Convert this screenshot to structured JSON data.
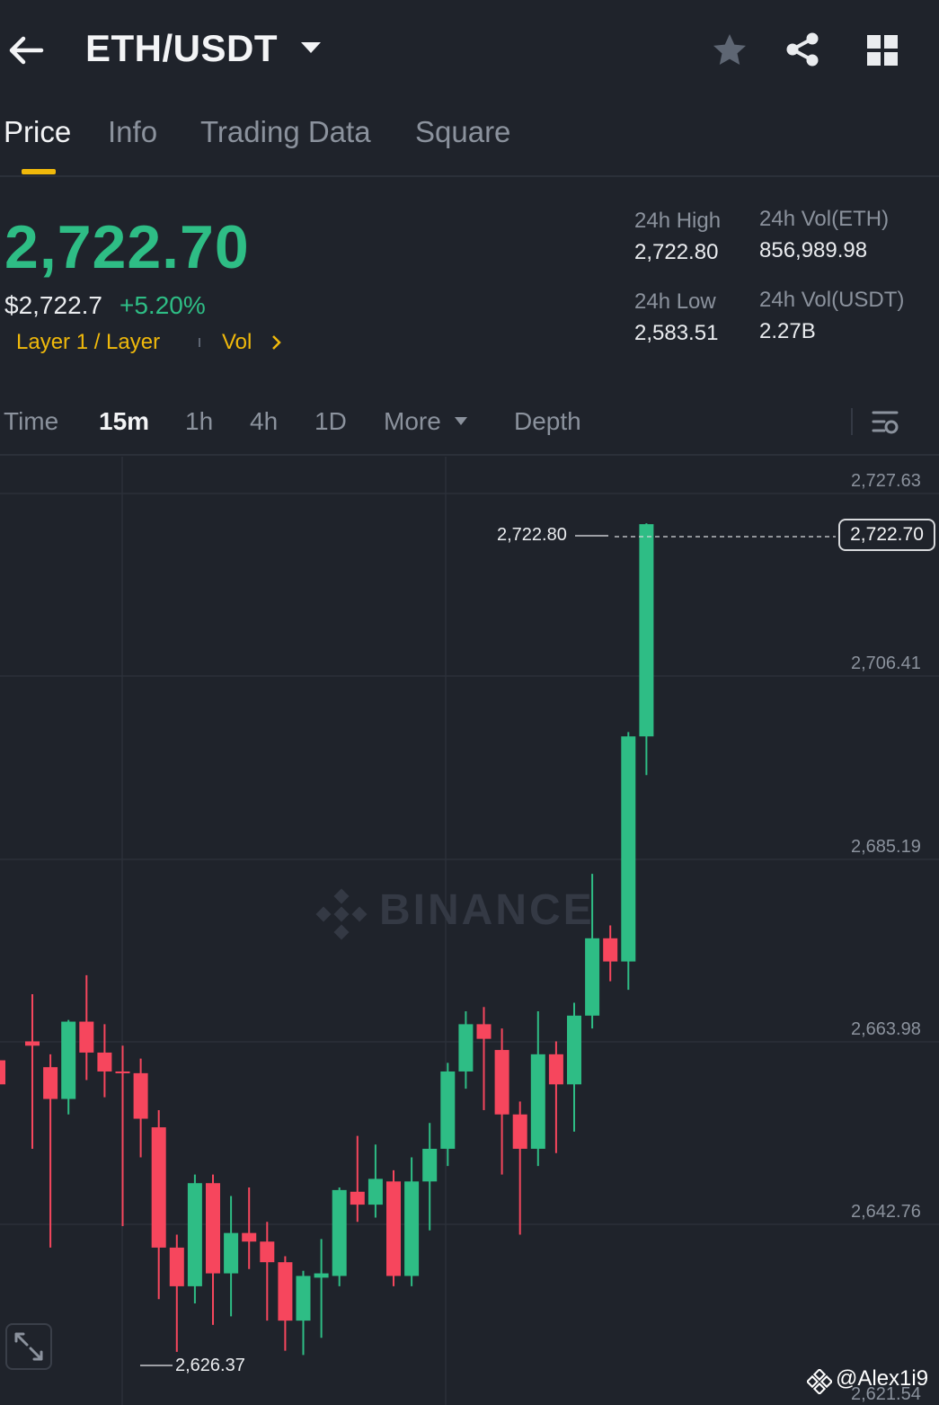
{
  "header": {
    "pair": "ETH/USDT",
    "back_icon": "back-arrow-icon",
    "dropdown_icon": "caret-down-icon",
    "favorite_icon": "star-icon",
    "share_icon": "share-icon",
    "grid_icon": "grid-icon"
  },
  "tabs": [
    {
      "label": "Price",
      "active": true
    },
    {
      "label": "Info"
    },
    {
      "label": "Trading Data"
    },
    {
      "label": "Square"
    }
  ],
  "ticker": {
    "last_price": "2,722.70",
    "fiat_price": "$2,722.7",
    "change_pct": "+5.20%",
    "tag": "Layer 1 / Layer",
    "vol_link": "Vol",
    "stats": {
      "high_label": "24h High",
      "high_value": "2,722.80",
      "vol_eth_label": "24h Vol(ETH)",
      "vol_eth_value": "856,989.98",
      "low_label": "24h Low",
      "low_value": "2,583.51",
      "vol_usdt_label": "24h Vol(USDT)",
      "vol_usdt_value": "2.27B"
    }
  },
  "timeframes": {
    "items": [
      "Time",
      "15m",
      "1h",
      "4h",
      "1D",
      "More",
      "Depth"
    ],
    "active": "15m",
    "settings_icon": "chart-settings-icon"
  },
  "chart": {
    "y_labels": [
      "2,727.63",
      "2,706.41",
      "2,685.19",
      "2,663.98",
      "2,642.76",
      "2,621.54"
    ],
    "max_label": "2,722.80",
    "min_label": "2,626.37",
    "current_price": "2,722.70",
    "watermark": "BINANCE",
    "fullscreen_icon": "expand-icon"
  },
  "chart_data": {
    "type": "candlestick",
    "interval": "15m",
    "ylim": [
      2621.54,
      2727.63
    ],
    "colors": {
      "up": "#2ebd85",
      "down": "#f6465d"
    },
    "candles": [
      {
        "o": 2662.5,
        "h": 2668.0,
        "l": 2650.0,
        "c": 2662.0
      },
      {
        "o": 2659.5,
        "h": 2661.0,
        "l": 2638.5,
        "c": 2655.8
      },
      {
        "o": 2655.8,
        "h": 2665.0,
        "l": 2654.0,
        "c": 2664.8
      },
      {
        "o": 2664.8,
        "h": 2670.2,
        "l": 2658.0,
        "c": 2661.2
      },
      {
        "o": 2661.2,
        "h": 2664.5,
        "l": 2656.0,
        "c": 2659.0
      },
      {
        "o": 2659.0,
        "h": 2662.0,
        "l": 2641.0,
        "c": 2658.8
      },
      {
        "o": 2658.8,
        "h": 2660.5,
        "l": 2649.0,
        "c": 2653.5
      },
      {
        "o": 2652.5,
        "h": 2654.5,
        "l": 2632.5,
        "c": 2638.5
      },
      {
        "o": 2638.5,
        "h": 2640.0,
        "l": 2626.37,
        "c": 2634.0
      },
      {
        "o": 2634.0,
        "h": 2647.0,
        "l": 2632.0,
        "c": 2646.0
      },
      {
        "o": 2646.0,
        "h": 2647.0,
        "l": 2629.5,
        "c": 2635.5
      },
      {
        "o": 2635.5,
        "h": 2644.5,
        "l": 2630.5,
        "c": 2640.2
      },
      {
        "o": 2640.2,
        "h": 2645.5,
        "l": 2636.0,
        "c": 2639.2
      },
      {
        "o": 2639.2,
        "h": 2641.5,
        "l": 2630.0,
        "c": 2636.8
      },
      {
        "o": 2636.8,
        "h": 2637.5,
        "l": 2626.5,
        "c": 2630.0
      },
      {
        "o": 2630.0,
        "h": 2635.8,
        "l": 2626.0,
        "c": 2635.2
      },
      {
        "o": 2635.0,
        "h": 2639.5,
        "l": 2628.0,
        "c": 2635.5
      },
      {
        "o": 2635.2,
        "h": 2645.5,
        "l": 2634.0,
        "c": 2645.2
      },
      {
        "o": 2645.0,
        "h": 2651.5,
        "l": 2641.5,
        "c": 2643.5
      },
      {
        "o": 2643.5,
        "h": 2650.5,
        "l": 2642.0,
        "c": 2646.5
      },
      {
        "o": 2646.2,
        "h": 2647.5,
        "l": 2634.0,
        "c": 2635.2
      },
      {
        "o": 2635.2,
        "h": 2649.0,
        "l": 2634.0,
        "c": 2646.2
      },
      {
        "o": 2646.2,
        "h": 2653.0,
        "l": 2640.5,
        "c": 2650.0
      },
      {
        "o": 2650.0,
        "h": 2660.0,
        "l": 2648.0,
        "c": 2659.0
      },
      {
        "o": 2659.0,
        "h": 2666.0,
        "l": 2657.0,
        "c": 2664.5
      },
      {
        "o": 2664.5,
        "h": 2666.5,
        "l": 2654.5,
        "c": 2662.8
      },
      {
        "o": 2661.5,
        "h": 2664.0,
        "l": 2647.0,
        "c": 2654.0
      },
      {
        "o": 2654.0,
        "h": 2655.5,
        "l": 2640.0,
        "c": 2650.0
      },
      {
        "o": 2650.0,
        "h": 2666.0,
        "l": 2648.0,
        "c": 2661.0
      },
      {
        "o": 2661.0,
        "h": 2662.5,
        "l": 2649.5,
        "c": 2657.5
      },
      {
        "o": 2657.5,
        "h": 2667.0,
        "l": 2652.0,
        "c": 2665.5
      },
      {
        "o": 2665.5,
        "h": 2682.0,
        "l": 2664.0,
        "c": 2674.5
      },
      {
        "o": 2674.5,
        "h": 2676.0,
        "l": 2669.5,
        "c": 2671.8
      },
      {
        "o": 2671.8,
        "h": 2698.5,
        "l": 2668.5,
        "c": 2698.0
      },
      {
        "o": 2698.0,
        "h": 2722.8,
        "l": 2693.5,
        "c": 2722.7
      }
    ]
  }
}
